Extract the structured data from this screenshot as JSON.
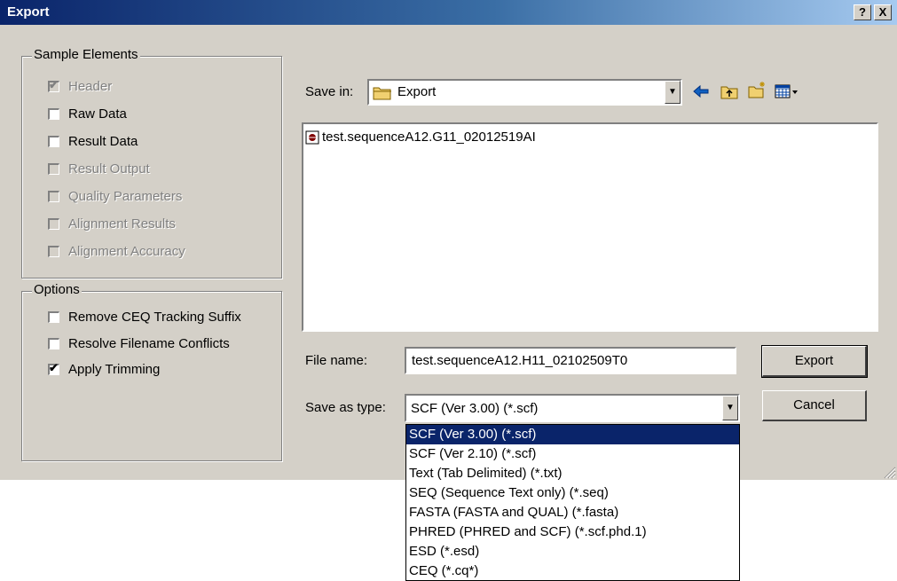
{
  "window": {
    "title": "Export",
    "help_glyph": "?",
    "close_glyph": "X"
  },
  "sample_elements": {
    "title": "Sample Elements",
    "items": [
      {
        "label": "Header",
        "checked": true,
        "enabled": false
      },
      {
        "label": "Raw Data",
        "checked": false,
        "enabled": true
      },
      {
        "label": "Result Data",
        "checked": false,
        "enabled": true
      },
      {
        "label": "Result Output",
        "checked": false,
        "enabled": false
      },
      {
        "label": "Quality Parameters",
        "checked": false,
        "enabled": false
      },
      {
        "label": "Alignment Results",
        "checked": false,
        "enabled": false
      },
      {
        "label": "Alignment Accuracy",
        "checked": false,
        "enabled": false
      }
    ]
  },
  "options": {
    "title": "Options",
    "items": [
      {
        "label": "Remove CEQ Tracking Suffix",
        "checked": false,
        "enabled": true
      },
      {
        "label": "Resolve Filename Conflicts",
        "checked": false,
        "enabled": true
      },
      {
        "label": "Apply Trimming",
        "checked": true,
        "enabled": true
      }
    ]
  },
  "save_in": {
    "label": "Save in:",
    "value": "Export",
    "icons": [
      "folder-icon",
      "back-arrow-icon",
      "up-folder-icon",
      "new-folder-icon",
      "view-menu-icon"
    ]
  },
  "files": [
    {
      "name": "test.sequenceA12.G11_02012519AI",
      "icon": "sequence-file-icon"
    }
  ],
  "file_name": {
    "label": "File name:",
    "value": "test.sequenceA12.H11_02102509T0"
  },
  "save_as_type": {
    "label": "Save as type:",
    "value": "SCF (Ver 3.00) (*.scf)",
    "options": [
      "SCF (Ver 3.00) (*.scf)",
      "SCF (Ver 2.10) (*.scf)",
      "Text (Tab Delimited) (*.txt)",
      "SEQ (Sequence Text only) (*.seq)",
      "FASTA (FASTA and QUAL) (*.fasta)",
      "PHRED (PHRED and SCF) (*.scf.phd.1)",
      "ESD (*.esd)",
      "CEQ (*.cq*)"
    ],
    "selected_option": "SCF (Ver 3.00) (*.scf)"
  },
  "buttons": {
    "export": "Export",
    "cancel": "Cancel"
  },
  "colors": {
    "title_bar": "#0a246a",
    "dialog_face": "#d4d0c8",
    "selection": "#0a246a"
  }
}
